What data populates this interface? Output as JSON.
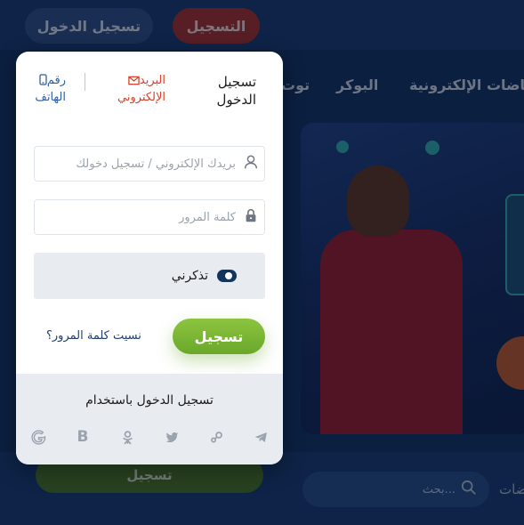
{
  "background": {
    "register_label": "التسجيل",
    "login_label": "تسجيل الدخول",
    "nav_items": [
      "الرياضات الإلكترونية",
      "البوكر",
      "توت"
    ],
    "bottom_register_label": "تسجيل",
    "search_placeholder": "بحث...",
    "edge_text": "ضات"
  },
  "login": {
    "title": "تسجيل الدخول",
    "tab_email": "البريد الإلكتروني",
    "tab_phone": "رقم الهاتف",
    "username_placeholder": "بريدك الإلكتروني / تسجيل دخولك",
    "password_placeholder": "كلمة المرور",
    "remember_label": "تذكرني",
    "remember_checked": true,
    "submit_label": "تسجيل",
    "forgot_label": "نسيت كلمة المرور؟",
    "social_title": "تسجيل الدخول باستخدام",
    "social_icons": [
      "google-icon",
      "blogger-icon",
      "odnoklassniki-icon",
      "twitter-icon",
      "steam-icon",
      "telegram-icon"
    ]
  },
  "colors": {
    "accent_green": "#7ab833",
    "email_tab": "#d7402a",
    "phone_tab": "#2e5fa0",
    "toggle": "#12365e"
  }
}
